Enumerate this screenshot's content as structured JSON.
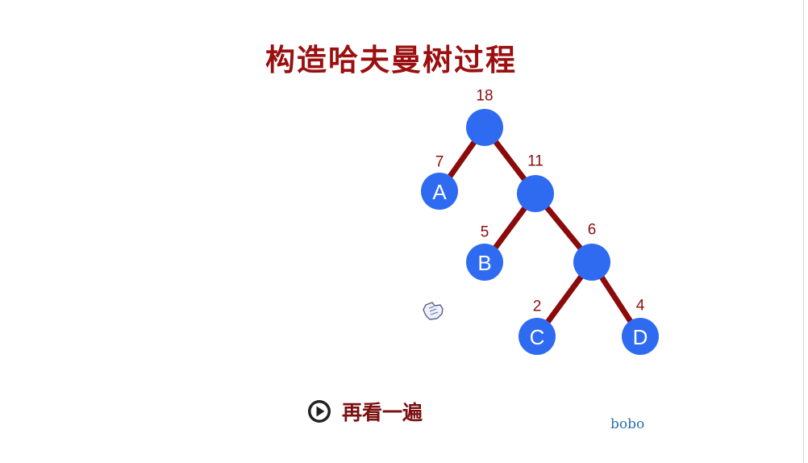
{
  "title": "构造哈夫曼树过程",
  "tree": {
    "nodes": [
      {
        "id": "n18",
        "label": "",
        "weight": "18"
      },
      {
        "id": "A",
        "label": "A",
        "weight": "7"
      },
      {
        "id": "n11",
        "label": "",
        "weight": "11"
      },
      {
        "id": "B",
        "label": "B",
        "weight": "5"
      },
      {
        "id": "n6",
        "label": "",
        "weight": "6"
      },
      {
        "id": "C",
        "label": "C",
        "weight": "2"
      },
      {
        "id": "D",
        "label": "D",
        "weight": "4"
      }
    ],
    "edges": [
      [
        "n18",
        "A"
      ],
      [
        "n18",
        "n11"
      ],
      [
        "n11",
        "B"
      ],
      [
        "n11",
        "n6"
      ],
      [
        "n6",
        "C"
      ],
      [
        "n6",
        "D"
      ]
    ],
    "node_color": "#2f6bf0",
    "edge_color": "#8b0a0a"
  },
  "replay": {
    "label": "再看一遍",
    "icon": "play-circle-icon"
  },
  "author": "bobo",
  "cursor_icon": "hand-pointer-icon"
}
